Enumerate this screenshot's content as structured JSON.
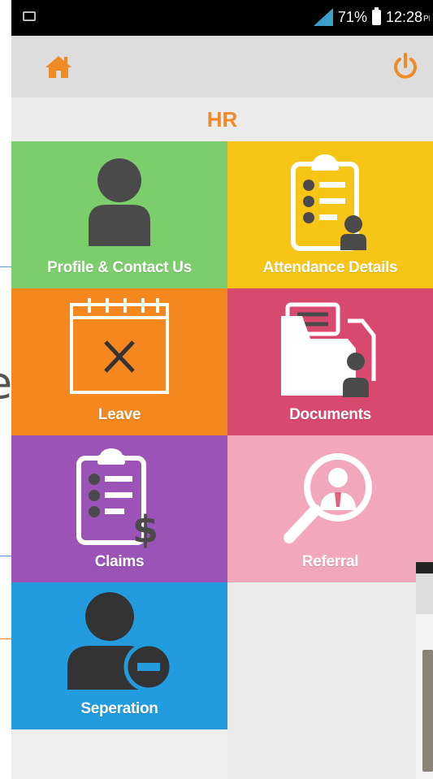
{
  "status_bar": {
    "battery_percent": "71%",
    "time": "12:28",
    "time_suffix": "PM",
    "icons": [
      "screenshot-icon",
      "signal-icon",
      "battery-icon"
    ]
  },
  "app_bar": {
    "icons": [
      "home-icon",
      "power-icon"
    ],
    "accent_color": "#f08a24"
  },
  "page": {
    "title": "HR"
  },
  "tiles": [
    {
      "label": "Profile & Contact Us",
      "icon": "person-icon",
      "color": "#7ccd6c"
    },
    {
      "label": "Attendance Details",
      "icon": "clipboard-checklist-user-icon",
      "color": "#f6c516"
    },
    {
      "label": "Leave",
      "icon": "calendar-cross-icon",
      "color": "#f5871f"
    },
    {
      "label": "Documents",
      "icon": "folder-user-icon",
      "color": "#d8496e"
    },
    {
      "label": "Claims",
      "icon": "clipboard-dollar-icon",
      "color": "#9b53b8"
    },
    {
      "label": "Referral",
      "icon": "magnifier-person-icon",
      "color": "#f2a7bd"
    },
    {
      "label": "Seperation",
      "icon": "user-minus-icon",
      "color": "#229cdf"
    }
  ],
  "background_slide": {
    "partial_letter": "e"
  }
}
